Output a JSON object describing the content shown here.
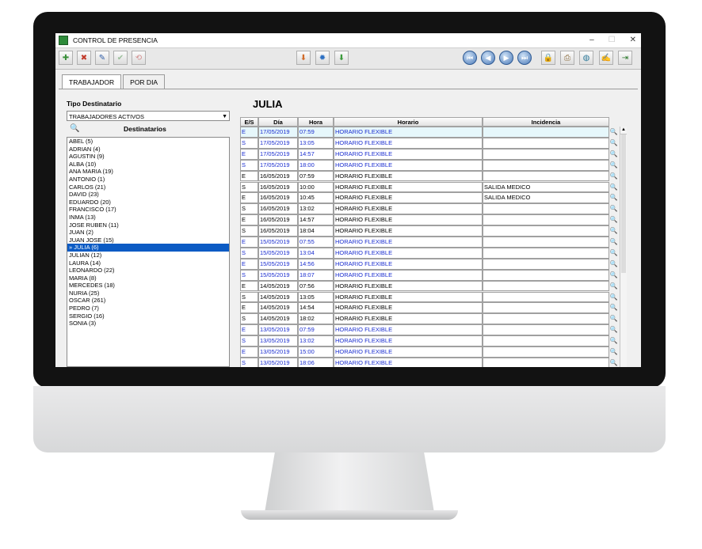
{
  "window": {
    "title": "CONTROL DE PRESENCIA",
    "min": "–",
    "max": "☐",
    "close": "✕"
  },
  "toolbar": [
    {
      "icon": "add-icon",
      "glyph": "✚",
      "color": "#3a8f3a"
    },
    {
      "icon": "delete-icon",
      "glyph": "✖",
      "color": "#c23a2a"
    },
    {
      "icon": "edit-icon",
      "glyph": "✎",
      "color": "#3460a8"
    },
    {
      "icon": "accept-icon",
      "glyph": "✔",
      "color": "#9bbf9b"
    },
    {
      "icon": "cancel-icon",
      "glyph": "⟲",
      "color": "#d38e8e"
    },
    {
      "icon": "import-icon",
      "glyph": "⬇",
      "color": "#d16b2a"
    },
    {
      "icon": "settings-icon",
      "glyph": "✹",
      "color": "#2c6fc2"
    },
    {
      "icon": "export-icon",
      "glyph": "⬇",
      "color": "#3b9a3b"
    },
    {
      "icon": "first-icon",
      "glyph": "⏮"
    },
    {
      "icon": "previous-icon",
      "glyph": "◀"
    },
    {
      "icon": "next-icon",
      "glyph": "▶"
    },
    {
      "icon": "last-icon",
      "glyph": "⏭"
    },
    {
      "icon": "lock-user-icon",
      "glyph": "🔒",
      "color": "#c9a12a"
    },
    {
      "icon": "print-icon",
      "glyph": "⎙",
      "color": "#8a6a3a"
    },
    {
      "icon": "globe-icon",
      "glyph": "◍",
      "color": "#2e7a9a"
    },
    {
      "icon": "notes-icon",
      "glyph": "✍",
      "color": "#555555"
    },
    {
      "icon": "exit-icon",
      "glyph": "⇥",
      "color": "#2d7a2d"
    }
  ],
  "tabs": [
    "TRABAJADOR",
    "POR DIA"
  ],
  "left": {
    "tipo_label": "Tipo Destinatario",
    "tipo_value": "TRABAJADORES ACTIVOS",
    "destinatarios_label": "Destinatarios",
    "list": [
      "ABEL (5)",
      "ADRIAN (4)",
      "AGUSTIN (9)",
      "ALBA (10)",
      "ANA MARIA (19)",
      "ANTONIO (1)",
      "CARLOS (21)",
      "DAVID (23)",
      "EDUARDO (20)",
      "FRANCISCO (17)",
      "INMA (13)",
      "JOSE RUBEN (11)",
      "JUAN (2)",
      "JUAN JOSE (15)",
      "» JULIA (6)",
      "JULIAN (12)",
      "LAURA (14)",
      "LEONARDO (22)",
      "MARIA (8)",
      "MERCEDES (18)",
      "NURIA (25)",
      "OSCAR (261)",
      "PEDRO (7)",
      "SERGIO (16)",
      "SONIA (3)"
    ],
    "selected_index": 14
  },
  "right": {
    "employee": "JULIA",
    "headers": [
      "E/S",
      "Día",
      "Hora",
      "Horario",
      "Incidencia"
    ],
    "rows": [
      {
        "es": "E",
        "dia": "17/05/2019",
        "hora": "07:59",
        "horario": "HORARIO FLEXIBLE",
        "inc": "",
        "blue": true
      },
      {
        "es": "S",
        "dia": "17/05/2019",
        "hora": "13:05",
        "horario": "HORARIO FLEXIBLE",
        "inc": "",
        "blue": true
      },
      {
        "es": "E",
        "dia": "17/05/2019",
        "hora": "14:57",
        "horario": "HORARIO FLEXIBLE",
        "inc": "",
        "blue": true
      },
      {
        "es": "S",
        "dia": "17/05/2019",
        "hora": "18:00",
        "horario": "HORARIO FLEXIBLE",
        "inc": "",
        "blue": true
      },
      {
        "es": "E",
        "dia": "16/05/2019",
        "hora": "07:59",
        "horario": "HORARIO FLEXIBLE",
        "inc": "",
        "blue": false
      },
      {
        "es": "S",
        "dia": "16/05/2019",
        "hora": "10:00",
        "horario": "HORARIO FLEXIBLE",
        "inc": "SALIDA MEDICO",
        "blue": false
      },
      {
        "es": "E",
        "dia": "16/05/2019",
        "hora": "10:45",
        "horario": "HORARIO FLEXIBLE",
        "inc": "SALIDA MEDICO",
        "blue": false
      },
      {
        "es": "S",
        "dia": "16/05/2019",
        "hora": "13:02",
        "horario": "HORARIO FLEXIBLE",
        "inc": "",
        "blue": false
      },
      {
        "es": "E",
        "dia": "16/05/2019",
        "hora": "14:57",
        "horario": "HORARIO FLEXIBLE",
        "inc": "",
        "blue": false
      },
      {
        "es": "S",
        "dia": "16/05/2019",
        "hora": "18:04",
        "horario": "HORARIO FLEXIBLE",
        "inc": "",
        "blue": false
      },
      {
        "es": "E",
        "dia": "15/05/2019",
        "hora": "07:55",
        "horario": "HORARIO FLEXIBLE",
        "inc": "",
        "blue": true
      },
      {
        "es": "S",
        "dia": "15/05/2019",
        "hora": "13:04",
        "horario": "HORARIO FLEXIBLE",
        "inc": "",
        "blue": true
      },
      {
        "es": "E",
        "dia": "15/05/2019",
        "hora": "14:56",
        "horario": "HORARIO FLEXIBLE",
        "inc": "",
        "blue": true
      },
      {
        "es": "S",
        "dia": "15/05/2019",
        "hora": "18:07",
        "horario": "HORARIO FLEXIBLE",
        "inc": "",
        "blue": true
      },
      {
        "es": "E",
        "dia": "14/05/2019",
        "hora": "07:56",
        "horario": "HORARIO FLEXIBLE",
        "inc": "",
        "blue": false
      },
      {
        "es": "S",
        "dia": "14/05/2019",
        "hora": "13:05",
        "horario": "HORARIO FLEXIBLE",
        "inc": "",
        "blue": false
      },
      {
        "es": "E",
        "dia": "14/05/2019",
        "hora": "14:54",
        "horario": "HORARIO FLEXIBLE",
        "inc": "",
        "blue": false
      },
      {
        "es": "S",
        "dia": "14/05/2019",
        "hora": "18:02",
        "horario": "HORARIO FLEXIBLE",
        "inc": "",
        "blue": false
      },
      {
        "es": "E",
        "dia": "13/05/2019",
        "hora": "07:59",
        "horario": "HORARIO FLEXIBLE",
        "inc": "",
        "blue": true
      },
      {
        "es": "S",
        "dia": "13/05/2019",
        "hora": "13:02",
        "horario": "HORARIO FLEXIBLE",
        "inc": "",
        "blue": true
      },
      {
        "es": "E",
        "dia": "13/05/2019",
        "hora": "15:00",
        "horario": "HORARIO FLEXIBLE",
        "inc": "",
        "blue": true
      },
      {
        "es": "S",
        "dia": "13/05/2019",
        "hora": "18:06",
        "horario": "HORARIO FLEXIBLE",
        "inc": "",
        "blue": true
      }
    ]
  }
}
